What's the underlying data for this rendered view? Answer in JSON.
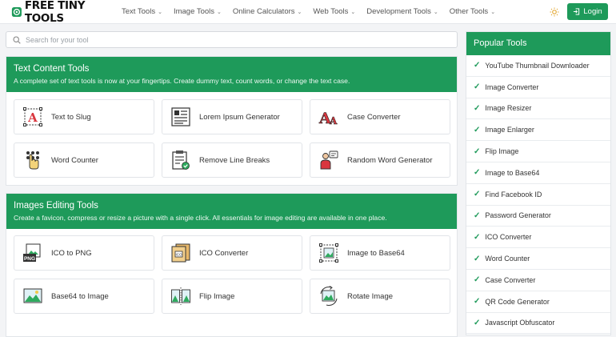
{
  "brand": {
    "name": "FREE TINY TOOLS",
    "accent": "#1e9a5a"
  },
  "nav": {
    "menu": [
      "Text Tools",
      "Image Tools",
      "Online Calculators",
      "Web Tools",
      "Development Tools",
      "Other Tools"
    ],
    "login_label": "Login"
  },
  "search": {
    "placeholder": "Search for your tool"
  },
  "sections": [
    {
      "title": "Text Content Tools",
      "description": "A complete set of text tools is now at your fingertips. Create dummy text, count words, or change the text case.",
      "tools": [
        {
          "label": "Text to Slug",
          "icon": "text-slug-icon"
        },
        {
          "label": "Lorem Ipsum Generator",
          "icon": "lorem-ipsum-icon"
        },
        {
          "label": "Case Converter",
          "icon": "case-converter-icon"
        },
        {
          "label": "Word Counter",
          "icon": "word-counter-icon"
        },
        {
          "label": "Remove Line Breaks",
          "icon": "remove-line-breaks-icon"
        },
        {
          "label": "Random Word Generator",
          "icon": "random-word-icon"
        }
      ]
    },
    {
      "title": "Images Editing Tools",
      "description": "Create a favicon, compress or resize a picture with a single click. All essentials for image editing are available in one place.",
      "tools": [
        {
          "label": "ICO to PNG",
          "icon": "ico-to-png-icon"
        },
        {
          "label": "ICO Converter",
          "icon": "ico-converter-icon"
        },
        {
          "label": "Image to Base64",
          "icon": "image-to-base64-icon"
        },
        {
          "label": "Base64 to Image",
          "icon": "base64-to-image-icon"
        },
        {
          "label": "Flip Image",
          "icon": "flip-image-icon"
        },
        {
          "label": "Rotate Image",
          "icon": "rotate-image-icon"
        }
      ]
    }
  ],
  "sidebar": {
    "title": "Popular Tools",
    "items": [
      "YouTube Thumbnail Downloader",
      "Image Converter",
      "Image Resizer",
      "Image Enlarger",
      "Flip Image",
      "Image to Base64",
      "Find Facebook ID",
      "Password Generator",
      "ICO Converter",
      "Word Counter",
      "Case Converter",
      "QR Code Generator",
      "Javascript Obfuscator"
    ]
  }
}
